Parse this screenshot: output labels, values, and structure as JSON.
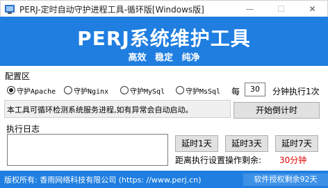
{
  "window": {
    "title": "PERJ-定时自动守护进程工具-循环版[Windows版]",
    "minimize": "—",
    "maximize": "☐",
    "close": "✕"
  },
  "banner": {
    "title": "PERJ系统维护工具",
    "tags": [
      "高效",
      "稳定",
      "纯净"
    ],
    "color": "#1f7ee0"
  },
  "config": {
    "section_label": "配置区",
    "options": [
      {
        "label": "守护Apache",
        "checked": true
      },
      {
        "label": "守护Nginx",
        "checked": false
      },
      {
        "label": "守护MySql",
        "checked": false
      },
      {
        "label": "守护MsSql",
        "checked": false
      }
    ],
    "every_label": "每",
    "interval_value": "30",
    "interval_suffix": "分钟执行1次",
    "info_text": "本工具可循环检测系统服务进程,如有异常会自动启动。",
    "start_button": "开始倒计时"
  },
  "log": {
    "section_label": "执行日志",
    "content": ""
  },
  "delay": {
    "buttons": [
      "延时1天",
      "延时3天",
      "延时7天"
    ],
    "remain_label": "距离执行设置操作剩余:",
    "remain_value": "30分钟",
    "remain_color": "#e00000"
  },
  "footer": {
    "copyright": "版权所有: 香雨网络科技有限公司 (https: //www.perj.cn)",
    "license": "软件授权剩余92天"
  }
}
